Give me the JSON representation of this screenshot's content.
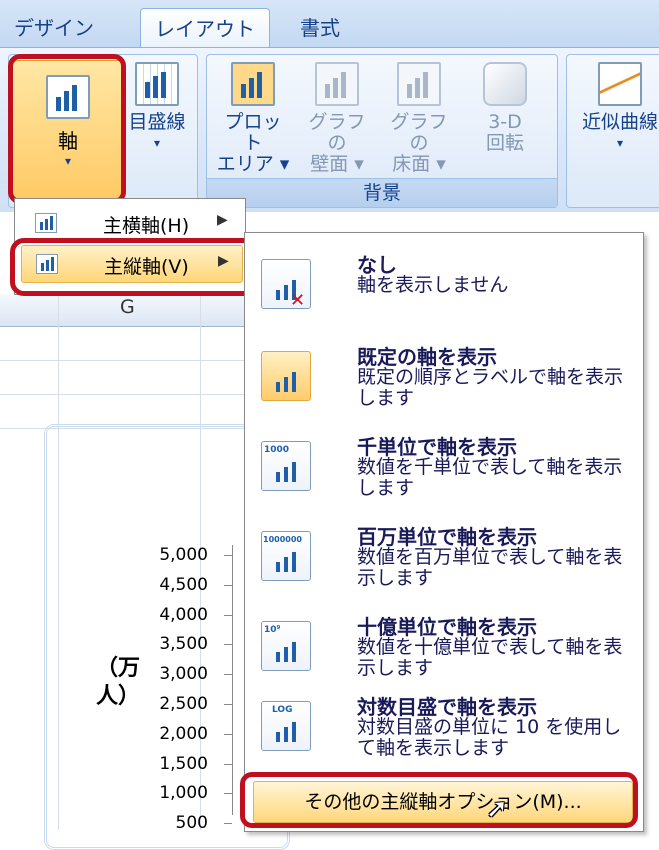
{
  "tabs": [
    "デザイン",
    "レイアウト",
    "書式"
  ],
  "ribbon": {
    "axis_button": "軸",
    "gridlines_button": "目盛線",
    "plot_area": [
      "プロット",
      "エリア ▾"
    ],
    "chart_wall": [
      "グラフの",
      "壁面 ▾"
    ],
    "chart_floor": [
      "グラフの",
      "床面 ▾"
    ],
    "rotation": [
      "3-D",
      "回転"
    ],
    "trendline": "近似曲線",
    "background_group": "背景"
  },
  "submenu": {
    "items": [
      {
        "label": "主横軸(H)"
      },
      {
        "label": "主縦軸(V)"
      }
    ]
  },
  "sheet": {
    "column": "G",
    "y_ticks": [
      "5,000",
      "4,500",
      "4,000",
      "3,500",
      "3,000",
      "2,500",
      "2,000",
      "1,500",
      "1,000",
      "500"
    ],
    "y_label": "（万人）"
  },
  "panel": {
    "options": [
      {
        "title": "なし",
        "desc": "軸を表示しません"
      },
      {
        "title": "既定の軸を表示",
        "desc": "既定の順序とラベルで軸を表示します"
      },
      {
        "title": "千単位で軸を表示",
        "desc": "数値を千単位で表して軸を表示します",
        "tag": "1000"
      },
      {
        "title": "百万単位で軸を表示",
        "desc": "数値を百万単位で表して軸を表示します",
        "tag": "1000000"
      },
      {
        "title": "十億単位で軸を表示",
        "desc": "数値を十億単位で表して軸を表示します",
        "tag": "10⁹"
      },
      {
        "title": "対数目盛で軸を表示",
        "desc": "対数目盛の単位に 10 を使用して軸を表示します",
        "tag": "LOG"
      }
    ],
    "more": "その他の主縦軸オプション(M)..."
  },
  "colors": {
    "highlight": "#ffd678",
    "callout": "#c01020",
    "ribbon_text": "#15428b"
  }
}
